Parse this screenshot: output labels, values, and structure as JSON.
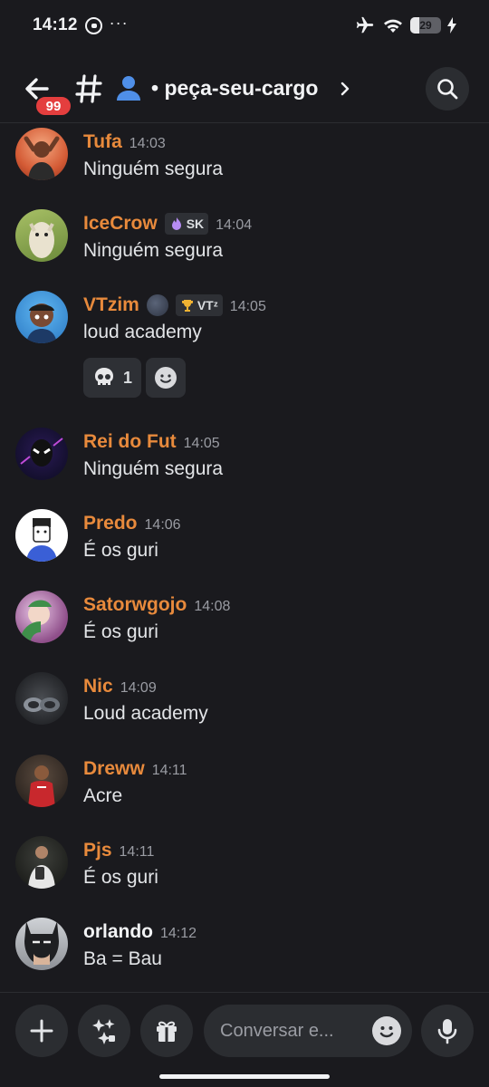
{
  "status_bar": {
    "time": "14:12",
    "notification_icons": [
      "whatsapp-icon",
      "more-dots-icon"
    ],
    "system_icons": [
      "airplane-icon",
      "wifi-icon",
      "battery-icon",
      "charging-bolt-icon"
    ],
    "battery_level": "29",
    "battery_fraction": 0.29
  },
  "header": {
    "unread_badge": "99",
    "channel_name": "peça-seu-cargo",
    "prefix_dot": "•",
    "icons": [
      "back-arrow-icon",
      "hash-icon",
      "user-icon",
      "chevron-right-icon",
      "search-icon"
    ]
  },
  "colors": {
    "background": "#1a1a1e",
    "username_accent": "#e88a3c",
    "badge_red": "#e43e3e",
    "bubble": "#2e3035",
    "text": "#e3e5e8",
    "timestamp": "#9a9ca3"
  },
  "messages": [
    {
      "user": "Tufa",
      "time": "14:03",
      "text": "Ninguém segura"
    },
    {
      "user": "IceCrow",
      "tag": "SK",
      "tag_icon": "purple-flame-icon",
      "time": "14:04",
      "text": "Ninguém segura"
    },
    {
      "user": "VTzim",
      "tag": "VTᶻ",
      "tag_icon": "trophy-icon",
      "time": "14:05",
      "text": "loud academy",
      "reaction": {
        "emoji": "skull-icon",
        "count": "1"
      }
    },
    {
      "user": "Rei do Fut",
      "time": "14:05",
      "text": "Ninguém segura"
    },
    {
      "user": "Predo",
      "time": "14:06",
      "text": "É os guri"
    },
    {
      "user": "Satorwgojo",
      "time": "14:08",
      "text": "É os guri"
    },
    {
      "user": "Nic",
      "time": "14:09",
      "text": "Loud academy"
    },
    {
      "user": "Dreww",
      "time": "14:11",
      "text": "Acre"
    },
    {
      "user": "Pjs",
      "time": "14:11",
      "text": "É os guri"
    },
    {
      "user": "orlando",
      "time": "14:12",
      "text": "Ba = Bau"
    }
  ],
  "composer": {
    "placeholder": "Conversar e...",
    "icons": [
      "plus-icon",
      "sparkle-apps-icon",
      "gift-icon",
      "emoji-icon",
      "microphone-icon"
    ]
  }
}
